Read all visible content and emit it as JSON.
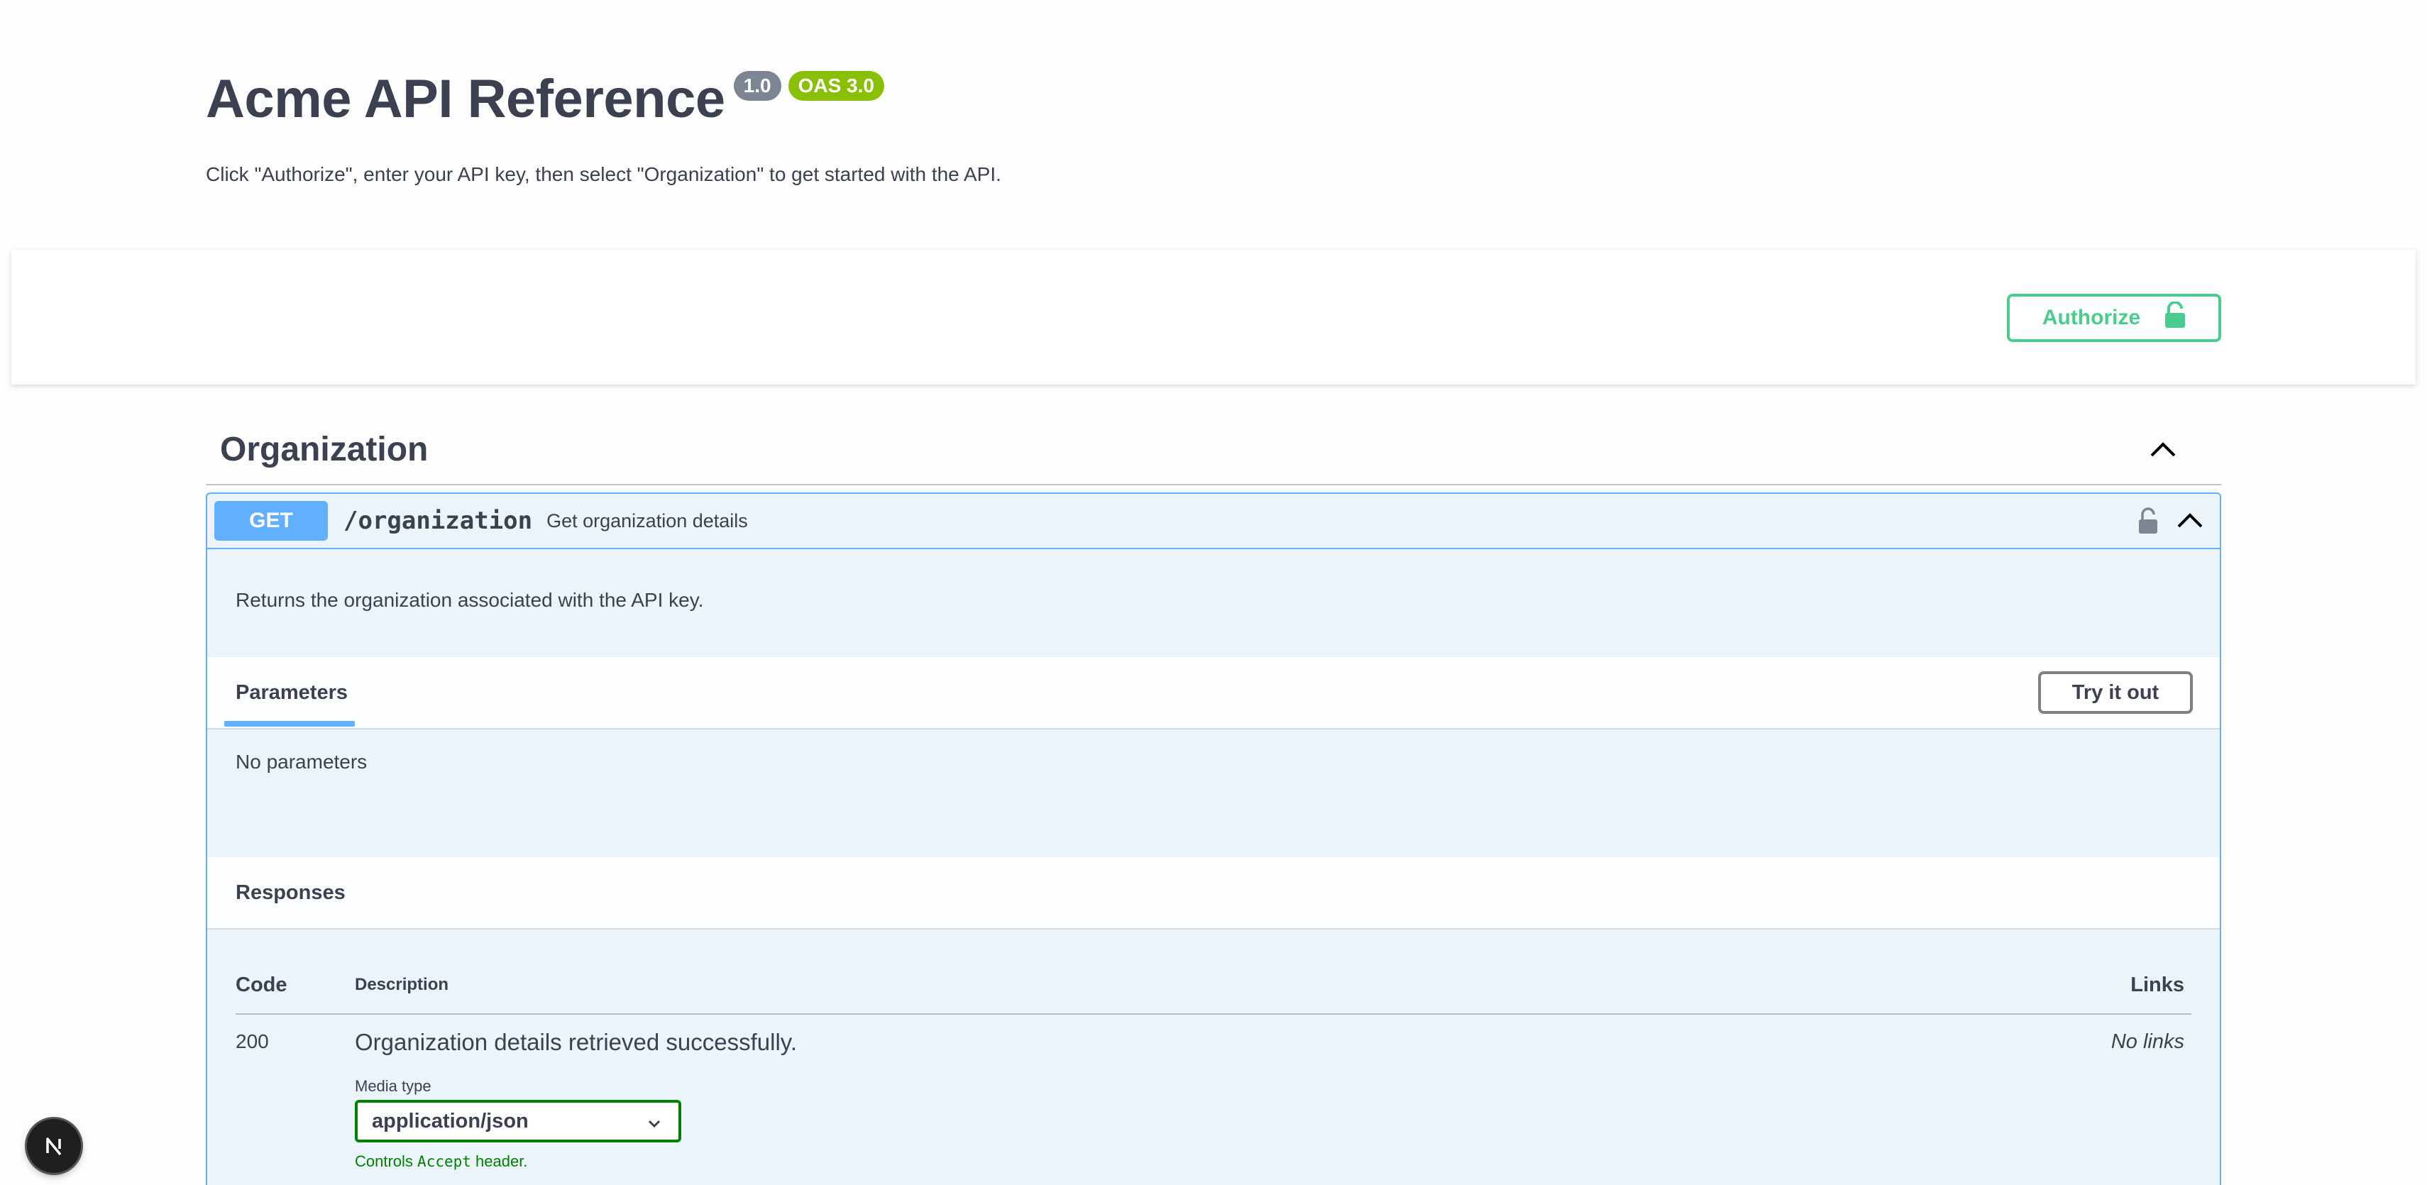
{
  "info": {
    "title": "Acme API Reference",
    "version": "1.0",
    "oas_badge": "OAS 3.0",
    "description": "Click \"Authorize\", enter your API key, then select \"Organization\" to get started with the API."
  },
  "scheme": {
    "authorize_label": "Authorize"
  },
  "tag": {
    "name": "Organization"
  },
  "operation": {
    "method": "GET",
    "path": "/organization",
    "summary": "Get organization details",
    "description": "Returns the organization associated with the API key.",
    "parameters_tab": "Parameters",
    "try_label": "Try it out",
    "no_params": "No parameters",
    "responses_title": "Responses",
    "table_headers": {
      "code": "Code",
      "description": "Description",
      "links": "Links"
    },
    "responses": [
      {
        "code": "200",
        "description": "Organization details retrieved successfully.",
        "links": "No links",
        "media_type_label": "Media type",
        "media_type": "application/json",
        "hint_prefix": "Controls ",
        "hint_code": "Accept",
        "hint_suffix": " header."
      }
    ]
  },
  "colors": {
    "get": "#61affe",
    "authorize": "#49cc90",
    "version_badge": "#7d8492",
    "oas_badge": "#89bf04",
    "select_border": "#008000"
  },
  "icons": {
    "authorize": "lock-open-icon",
    "operation_lock": "lock-open-icon",
    "collapse": "chevron-up-icon",
    "select": "chevron-down-icon",
    "nextjs": "nextjs-logo-icon"
  }
}
